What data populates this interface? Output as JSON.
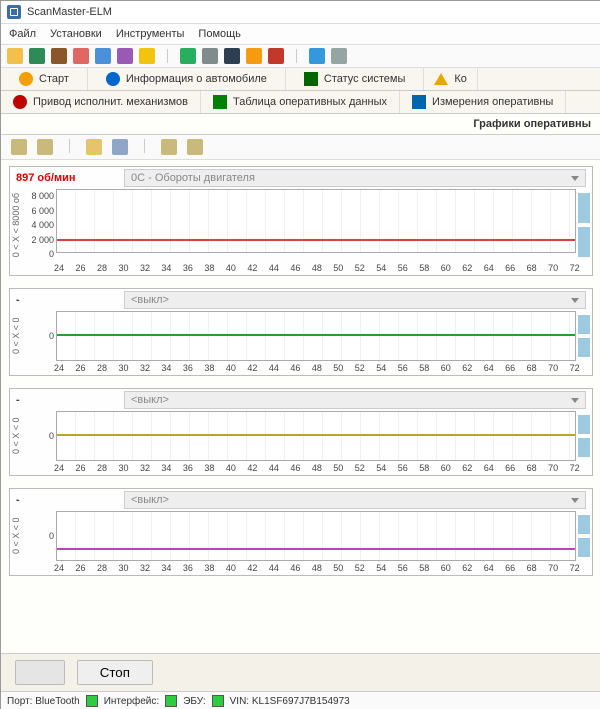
{
  "title": "ScanMaster-ELM",
  "menu": [
    "Файл",
    "Установки",
    "Инструменты",
    "Помощь"
  ],
  "tabs1": [
    {
      "label": "Старт",
      "iconColor": "#f2a000"
    },
    {
      "label": "Информация о автомобиле",
      "iconColor": "#0066cc"
    },
    {
      "label": "Статус системы",
      "iconColor": "#006600"
    },
    {
      "label": "Ко",
      "iconColor": "#e68a00",
      "warning": true
    }
  ],
  "tabs2": [
    {
      "label": "Привод исполнит. механизмов",
      "iconColor": "#c00000"
    },
    {
      "label": "Таблица оперативных данных",
      "iconColor": "#008000"
    },
    {
      "label": "Измерения оперативны",
      "iconColor": "#0066aa"
    }
  ],
  "pageTitle": "Графики оперативны",
  "charts": [
    {
      "value": "897 об/мин",
      "valueColor": "#d00",
      "dropdown": "0C - Обороты двигателя",
      "ylabel": "0 < X < 8000 об",
      "yticks": [
        "8 000",
        "6 000",
        "4 000",
        "2 000",
        "0"
      ],
      "lineColor": "#d94040",
      "lineBottomPct": 18,
      "height": 62
    },
    {
      "value": "-",
      "dropdown": "<выкл>",
      "ylabel": "0 < X < 0",
      "yticks": [
        "",
        "0",
        ""
      ],
      "lineColor": "#2a9d2a",
      "lineBottomPct": 50,
      "height": 48
    },
    {
      "value": "-",
      "dropdown": "<выкл>",
      "ylabel": "0 < X < 0",
      "yticks": [
        "",
        "0",
        ""
      ],
      "lineColor": "#b8a52a",
      "lineBottomPct": 50,
      "height": 48
    },
    {
      "value": "-",
      "dropdown": "<выкл>",
      "ylabel": "0 < X < 0",
      "yticks": [
        "",
        "0",
        ""
      ],
      "lineColor": "#c040c0",
      "lineBottomPct": 22,
      "height": 48
    }
  ],
  "xticks": [
    "24",
    "26",
    "28",
    "30",
    "32",
    "34",
    "36",
    "38",
    "40",
    "42",
    "44",
    "46",
    "48",
    "50",
    "52",
    "54",
    "56",
    "58",
    "60",
    "62",
    "64",
    "66",
    "68",
    "70",
    "72"
  ],
  "buttons": {
    "start": "",
    "stop": "Стоп"
  },
  "status": {
    "port": "Порт: BlueTooth",
    "iface": "Интерфейс:",
    "ecu": "ЭБУ:",
    "vin": "VIN: KL1SF697J7B154973"
  },
  "chart_data": [
    {
      "type": "line",
      "title": "0C - Обороты двигателя",
      "ylabel": "об/мин",
      "ylim": [
        0,
        8000
      ],
      "x_range": [
        24,
        72
      ],
      "current_value": 897,
      "approx_constant_y": 900
    },
    {
      "type": "line",
      "title": "<выкл>",
      "ylim": [
        0,
        0
      ],
      "x_range": [
        24,
        72
      ],
      "approx_constant_y": 0
    },
    {
      "type": "line",
      "title": "<выкл>",
      "ylim": [
        0,
        0
      ],
      "x_range": [
        24,
        72
      ],
      "approx_constant_y": 0
    },
    {
      "type": "line",
      "title": "<выкл>",
      "ylim": [
        0,
        0
      ],
      "x_range": [
        24,
        72
      ],
      "approx_constant_y": 0
    }
  ]
}
